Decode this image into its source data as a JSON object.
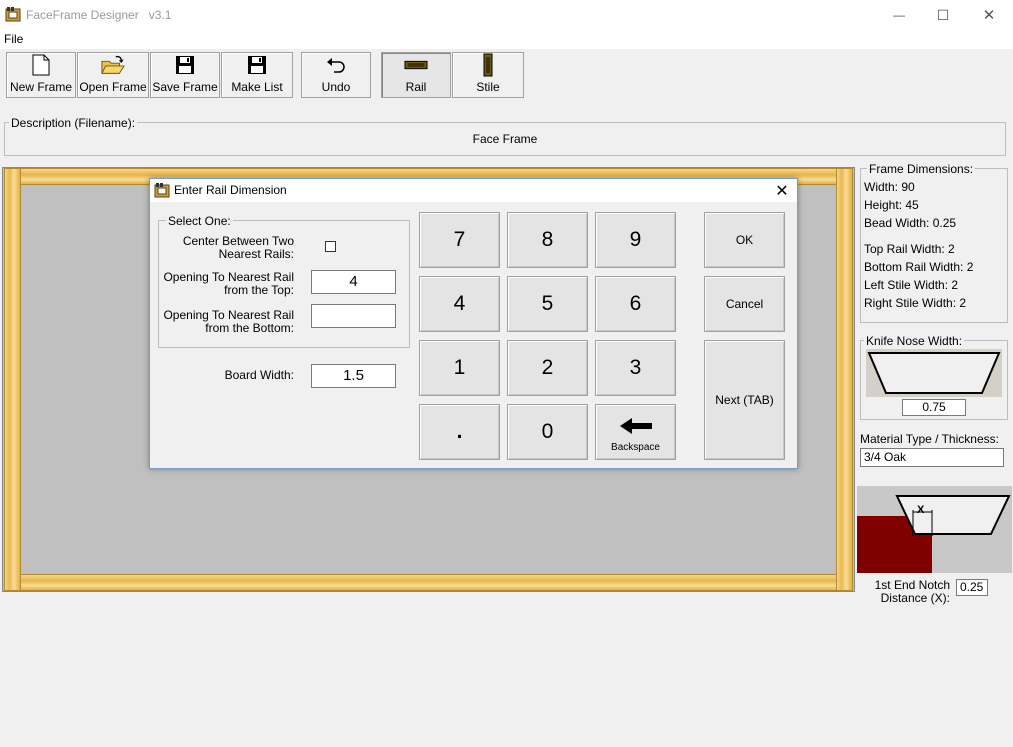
{
  "window": {
    "title": "FaceFrame Designer   v3.1",
    "minimize_glyph": "—",
    "maximize_glyph": "☐",
    "close_glyph": "✕"
  },
  "menu": {
    "file": "File"
  },
  "toolbar": {
    "new_frame": "New Frame",
    "open_frame": "Open Frame",
    "save_frame": "Save Frame",
    "make_list": "Make List",
    "undo": "Undo",
    "rail": "Rail",
    "stile": "Stile"
  },
  "description": {
    "label": "Description (Filename):",
    "value": "Face Frame"
  },
  "frame_dimensions": {
    "label": "Frame Dimensions:",
    "width": "Width: 90",
    "height": "Height: 45",
    "bead_width": "Bead Width: 0.25",
    "top_rail_width": "Top Rail Width: 2",
    "bottom_rail_width": "Bottom Rail Width: 2",
    "left_stile_width": "Left Stile Width: 2",
    "right_stile_width": "Right Stile Width: 2"
  },
  "knife_nose": {
    "label": "Knife Nose Width:",
    "value": "0.75"
  },
  "material": {
    "label": "Material Type / Thickness:",
    "value": "3/4 Oak"
  },
  "notch": {
    "marker": "X",
    "label_line1": "1st End Notch",
    "label_line2": "Distance (X):",
    "value": "0.25"
  },
  "dialog": {
    "title": "Enter Rail Dimension",
    "close_glyph": "✕",
    "select_one": "Select One:",
    "center_label_1": "Center Between Two",
    "center_label_2": "Nearest Rails:",
    "top_label_1": "Opening To Nearest Rail",
    "top_label_2": "from the Top:",
    "top_value": "4",
    "bottom_label_1": "Opening To Nearest Rail",
    "bottom_label_2": "from the Bottom:",
    "bottom_value": "",
    "board_width_label": "Board Width:",
    "board_width_value": "1.5",
    "keys": [
      "7",
      "8",
      "9",
      "4",
      "5",
      "6",
      "1",
      "2",
      "3",
      ".",
      "0"
    ],
    "backspace": "Backspace",
    "ok": "OK",
    "cancel": "Cancel",
    "next": "Next (TAB)"
  },
  "colors": {
    "wood": "#e8b94e",
    "notch_block": "#800000",
    "frame_gray": "#c0c0c0"
  }
}
